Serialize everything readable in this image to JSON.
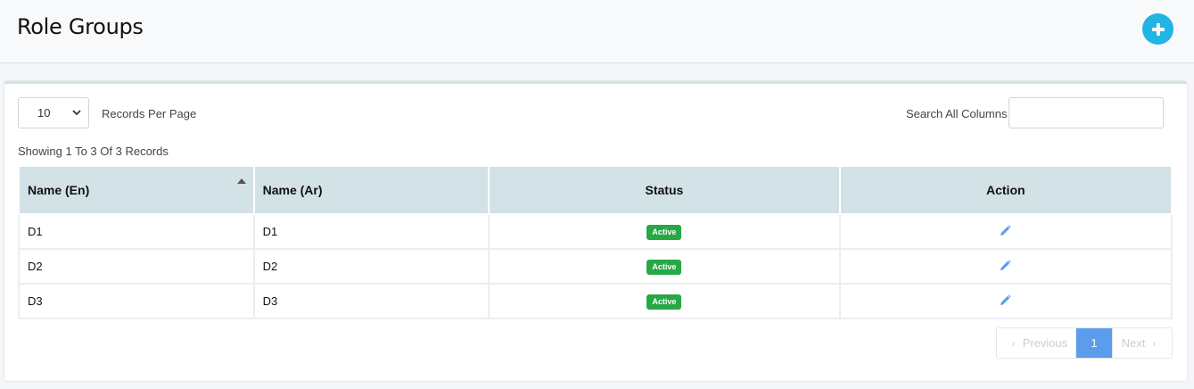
{
  "header": {
    "title": "Role Groups",
    "add_icon": "plus-circle-icon",
    "accent_color": "#21b4e4"
  },
  "controls": {
    "page_size_value": "10",
    "records_per_page_label": "Records Per Page",
    "search_label": "Search All Columns",
    "search_value": "",
    "showing_text": "Showing 1 To 3 Of 3 Records"
  },
  "table": {
    "columns": [
      "Name (En)",
      "Name (Ar)",
      "Status",
      "Action"
    ],
    "rows": [
      {
        "name_en": "D1",
        "name_ar": "D1",
        "status": "Active",
        "action_icon": "pencil-icon"
      },
      {
        "name_en": "D2",
        "name_ar": "D2",
        "status": "Active",
        "action_icon": "pencil-icon"
      },
      {
        "name_en": "D3",
        "name_ar": "D3",
        "status": "Active",
        "action_icon": "pencil-icon"
      }
    ],
    "sort_column": "Name (En)",
    "sort_direction": "ascending",
    "status_color": "#28a745"
  },
  "pagination": {
    "prev_label": "Previous",
    "current_page": "1",
    "next_label": "Next",
    "active_color": "#5b9ded"
  }
}
